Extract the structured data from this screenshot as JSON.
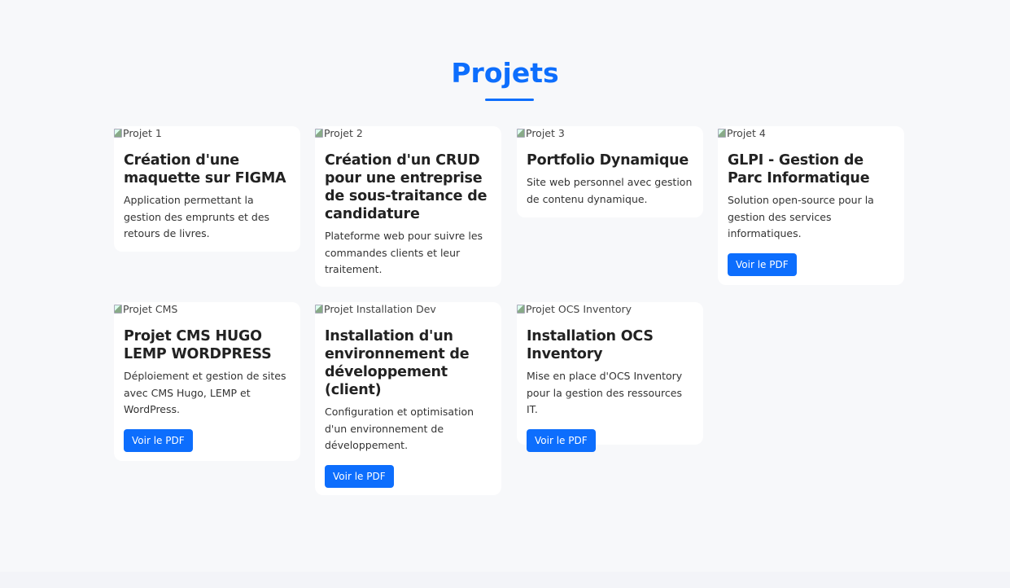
{
  "section": {
    "title": "Projets"
  },
  "projects": [
    {
      "img_alt": "Projet 1",
      "title": "Création d'une maquette sur FIGMA",
      "description": "Application permettant la gestion des emprunts et des retours de livres."
    },
    {
      "img_alt": "Projet 2",
      "title": "Création d'un CRUD pour une entreprise de sous-traitance de candidature",
      "description": "Plateforme web pour suivre les commandes clients et leur traitement."
    },
    {
      "img_alt": "Projet 3",
      "title": "Portfolio Dynamique",
      "description": "Site web personnel avec gestion de contenu dynamique."
    },
    {
      "img_alt": "Projet 4",
      "title": "GLPI - Gestion de Parc Informatique",
      "description": "Solution open-source pour la gestion des services informatiques.",
      "button": "Voir le PDF"
    },
    {
      "img_alt": "Projet CMS",
      "title": "Projet CMS HUGO LEMP WORDPRESS",
      "description": "Déploiement et gestion de sites avec CMS Hugo, LEMP et WordPress.",
      "button": "Voir le PDF"
    },
    {
      "img_alt": "Projet Installation Dev",
      "title": "Installation d'un environnement de développement (client)",
      "description": "Configuration et optimisation d'un environnement de développement.",
      "button": "Voir le PDF"
    },
    {
      "img_alt": "Projet OCS Inventory",
      "title": "Installation OCS Inventory",
      "description": "Mise en place d'OCS Inventory pour la gestion des ressources IT.",
      "button": "Voir le PDF"
    }
  ]
}
